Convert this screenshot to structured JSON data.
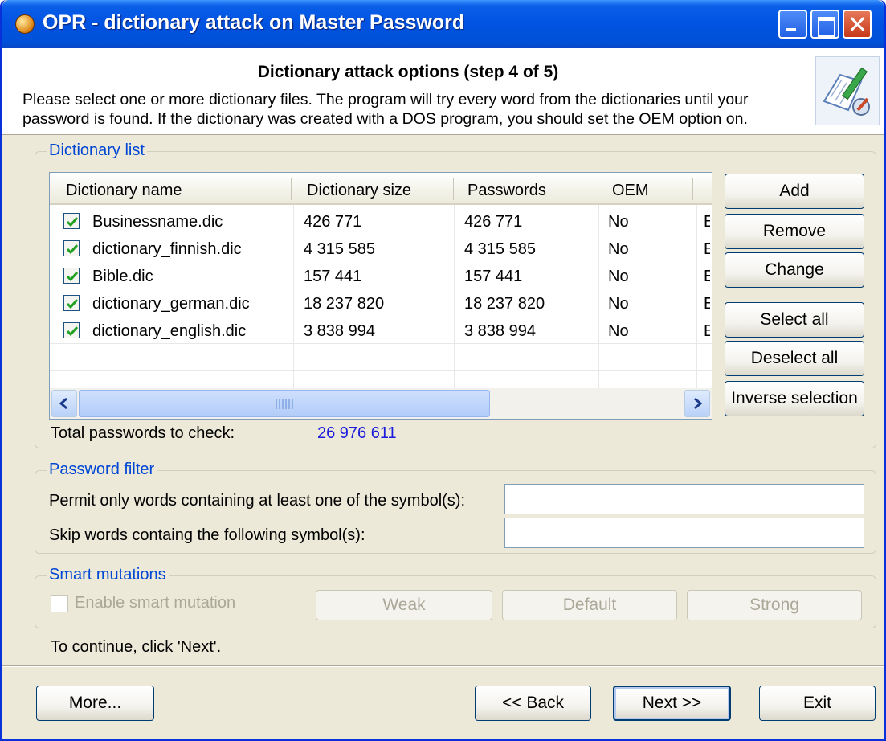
{
  "window": {
    "title": "OPR - dictionary attack on Master Password"
  },
  "header": {
    "step_title": "Dictionary attack options (step 4 of 5)",
    "description": "Please select one or more dictionary files. The program will try every word from the dictionaries until your password is found. If the dictionary was created with a DOS program, you should set the OEM option on."
  },
  "dictionary_list": {
    "group_label": "Dictionary list",
    "columns": [
      "Dictionary name",
      "Dictionary size",
      "Passwords",
      "OEM"
    ],
    "rows": [
      {
        "checked": true,
        "name": "Businessname.dic",
        "size": "426 771",
        "passwords": "426 771",
        "oem": "No",
        "extra": "E"
      },
      {
        "checked": true,
        "name": "dictionary_finnish.dic",
        "size": "4 315 585",
        "passwords": "4 315 585",
        "oem": "No",
        "extra": "E"
      },
      {
        "checked": true,
        "name": "Bible.dic",
        "size": "157 441",
        "passwords": "157 441",
        "oem": "No",
        "extra": "E"
      },
      {
        "checked": true,
        "name": "dictionary_german.dic",
        "size": "18 237 820",
        "passwords": "18 237 820",
        "oem": "No",
        "extra": "E"
      },
      {
        "checked": true,
        "name": "dictionary_english.dic",
        "size": "3 838 994",
        "passwords": "3 838 994",
        "oem": "No",
        "extra": "E"
      }
    ],
    "buttons": {
      "add": "Add",
      "remove": "Remove",
      "change": "Change",
      "select_all": "Select all",
      "deselect_all": "Deselect all",
      "inverse": "Inverse selection"
    },
    "total_label": "Total passwords to check:",
    "total_value": "26 976 611"
  },
  "password_filter": {
    "group_label": "Password filter",
    "permit_label": "Permit only  words containing at least one of the symbol(s):",
    "permit_value": "",
    "skip_label": "Skip words containg the following symbol(s):",
    "skip_value": ""
  },
  "smart_mutations": {
    "group_label": "Smart mutations",
    "enable_label": "Enable smart mutation",
    "weak": "Weak",
    "default": "Default",
    "strong": "Strong"
  },
  "footer": {
    "continue_text": "To continue, click 'Next'.",
    "more": "More...",
    "back": "<< Back",
    "next": "Next >>",
    "exit": "Exit"
  },
  "colors": {
    "title_bar": "#0053e1",
    "group_label": "#0046d5",
    "total_value": "#1b1bdc"
  }
}
